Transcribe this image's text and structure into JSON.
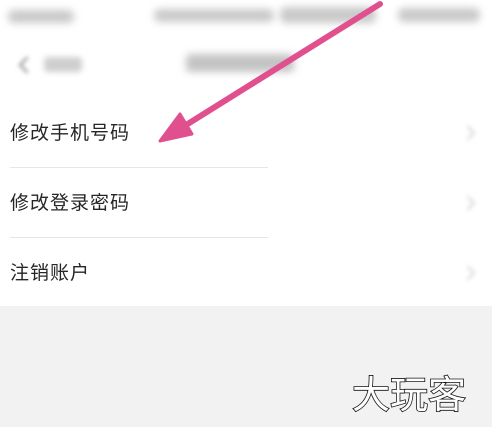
{
  "settings": {
    "items": [
      {
        "label": "修改手机号码"
      },
      {
        "label": "修改登录密码"
      },
      {
        "label": "注销账户"
      }
    ]
  },
  "watermark": {
    "text": "大玩客"
  },
  "colors": {
    "panel_background": "#ffffff",
    "page_background": "#f2f2f2",
    "arrow": "#e0508f",
    "text": "#262626",
    "divider": "#e6e6e6"
  },
  "icons": {
    "back": "chevron-left-icon",
    "item_arrow": "chevron-right-icon"
  }
}
